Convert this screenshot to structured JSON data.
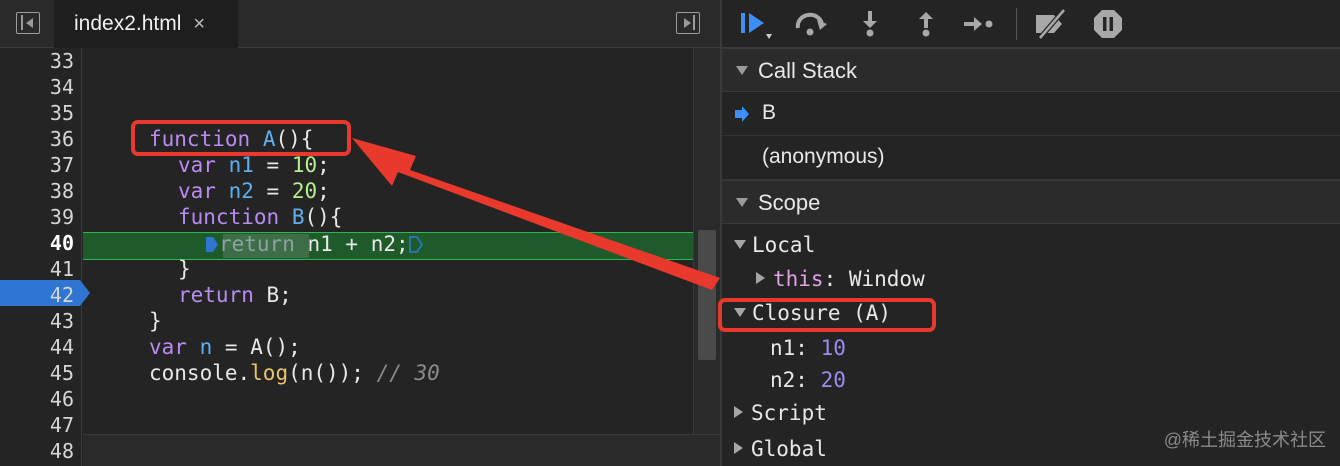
{
  "editor": {
    "tab": {
      "filename": "index2.html",
      "close": "×"
    },
    "line_numbers": [
      "33",
      "34",
      "35",
      "36",
      "37",
      "38",
      "39",
      "40",
      "41",
      "42",
      "43",
      "44",
      "45",
      "46",
      "47",
      "48"
    ],
    "current_line": "40",
    "code": {
      "l36": {
        "kw": "function",
        "name": "A",
        "rest": "(){"
      },
      "l37": {
        "kw": "var",
        "name": "n1",
        "eq": " = ",
        "num": "10",
        "end": ";"
      },
      "l38": {
        "kw": "var",
        "name": "n2",
        "eq": " = ",
        "num": "20",
        "end": ";"
      },
      "l39": {
        "kw": "function",
        "name": "B",
        "rest": "(){"
      },
      "l40": {
        "kw": "return",
        "rest": " n1 + n2;"
      },
      "l41": "}",
      "l42": {
        "kw": "return",
        "rest": " B;"
      },
      "l43": "}",
      "l44": {
        "kw": "var",
        "name": "n",
        "eq": " = ",
        "rest": "A();"
      },
      "l45": {
        "obj": "console.",
        "method": "log",
        "rest": "(n()); ",
        "comment": "// 30"
      }
    }
  },
  "debugger": {
    "call_stack": {
      "title": "Call Stack",
      "frames": [
        "B",
        "(anonymous)"
      ]
    },
    "scope": {
      "title": "Scope",
      "local": {
        "label": "Local",
        "this_key": "this",
        "this_val": ": Window"
      },
      "closure": {
        "label": "Closure (A)",
        "vars": [
          {
            "name": "n1",
            "value": "10"
          },
          {
            "name": "n2",
            "value": "20"
          }
        ]
      },
      "script": "Script",
      "global": "Global"
    }
  },
  "watermark": "@稀土掘金技术社区",
  "icons": {
    "resume": "resume-icon",
    "step_over": "step-over-icon",
    "step_into": "step-into-icon",
    "step_out": "step-out-icon",
    "step": "step-icon",
    "deactivate": "deactivate-breakpoints-icon",
    "pause_exceptions": "pause-on-exceptions-icon"
  },
  "colors": {
    "accent_blue": "#2f76d3",
    "exec_line": "#1f5a2a",
    "annotation_red": "#e8392c"
  }
}
